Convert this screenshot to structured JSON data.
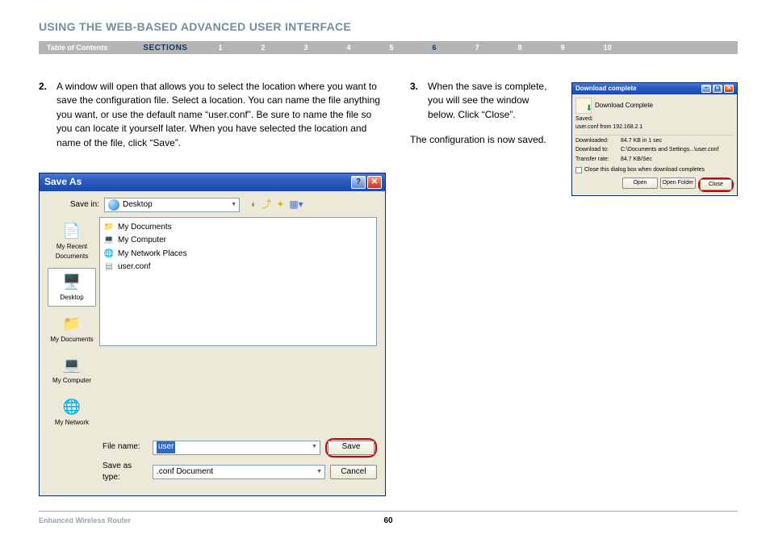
{
  "page_title": "USING THE WEB-BASED ADVANCED USER INTERFACE",
  "nav": {
    "toc": "Table of Contents",
    "sections": "SECTIONS",
    "items": [
      "1",
      "2",
      "3",
      "4",
      "5",
      "6",
      "7",
      "8",
      "9",
      "10"
    ],
    "active": "6"
  },
  "step2": {
    "num": "2.",
    "text": "A window will open that allows you to select the location where you want to save the configuration file. Select a location. You can name the file anything you want, or use the default name “user.conf”. Be sure to name the file so you can locate it yourself later. When you have selected the location and name of the file, click “Save”."
  },
  "step3": {
    "num": "3.",
    "text": "When the save is complete, you will see the window below. Click “Close”.",
    "extra": "The configuration is now saved."
  },
  "saveas": {
    "title": "Save As",
    "save_in_label": "Save in:",
    "save_in_value": "Desktop",
    "places": [
      "My Recent Documents",
      "Desktop",
      "My Documents",
      "My Computer",
      "My Network"
    ],
    "files": [
      "My Documents",
      "My Computer",
      "My Network Places",
      "user.conf"
    ],
    "filename_label": "File name:",
    "filename_value": "user",
    "saveastype_label": "Save as type:",
    "saveastype_value": ".conf Document",
    "save_btn": "Save",
    "cancel_btn": "Cancel"
  },
  "dl": {
    "title": "Download complete",
    "head": "Download Complete",
    "saved_label": "Saved:",
    "saved_value": "user.conf from 192.168.2.1",
    "downloaded_k": "Downloaded:",
    "downloaded_v": "84.7 KB in 1 sec",
    "downloadto_k": "Download to:",
    "downloadto_v": "C:\\Documents and Settings...\\user.conf",
    "transfer_k": "Transfer rate:",
    "transfer_v": "84.7 KB/Sec",
    "checkbox": "Close this dialog box when download completes",
    "open": "Open",
    "openfolder": "Open Folder",
    "close": "Close"
  },
  "footer": {
    "left": "Enhanced Wireless Router",
    "page": "60"
  }
}
